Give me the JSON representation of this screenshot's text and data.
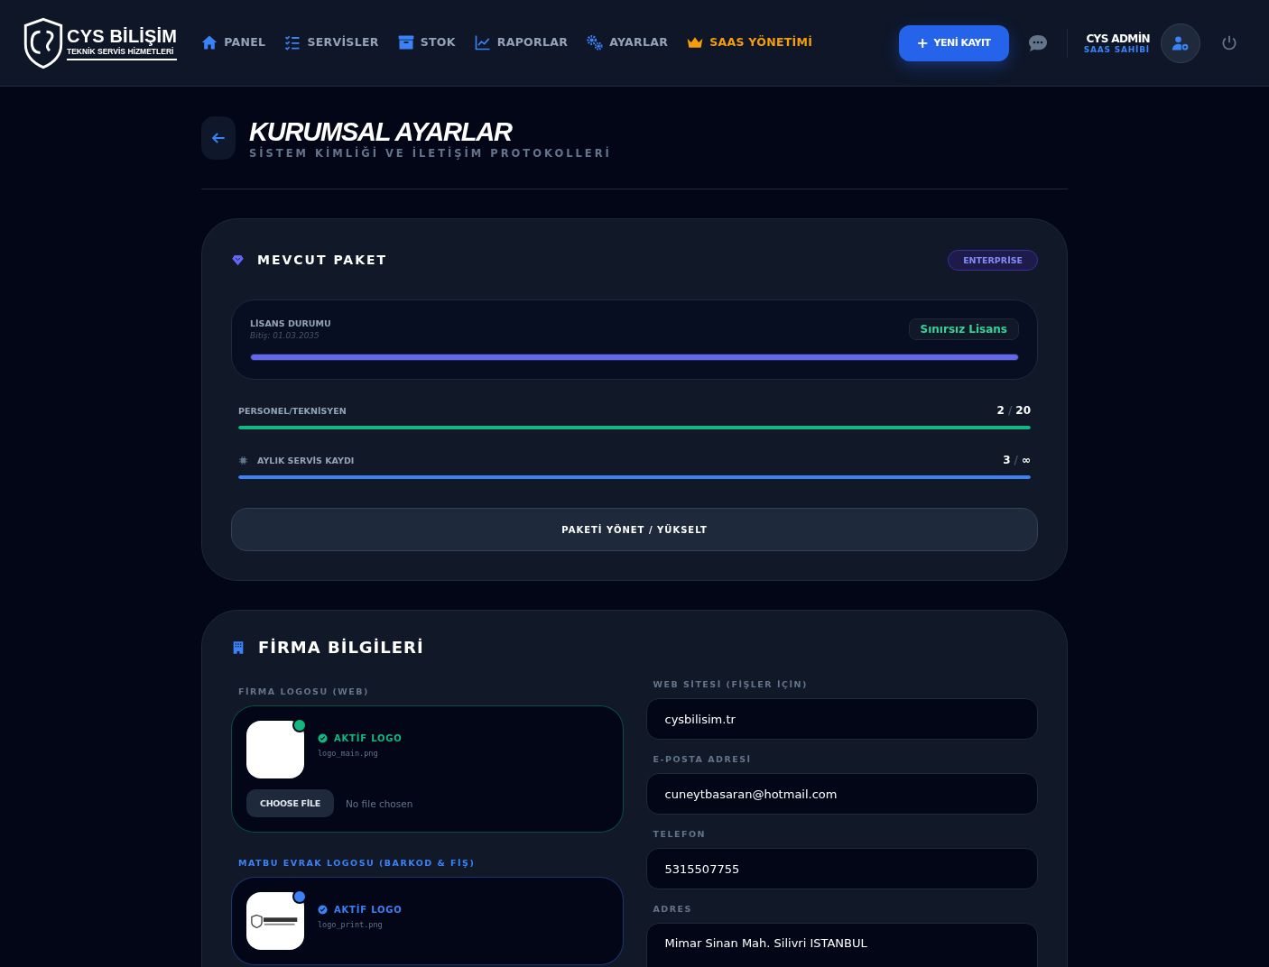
{
  "header": {
    "logo": {
      "title": "CYS BİLİŞİM",
      "subtitle": "TEKNİK SERVİS HİZMETLERİ"
    },
    "nav": [
      {
        "label": "PANEL",
        "kind": "normal"
      },
      {
        "label": "SERVİSLER",
        "kind": "normal"
      },
      {
        "label": "STOK",
        "kind": "normal"
      },
      {
        "label": "RAPORLAR",
        "kind": "normal"
      },
      {
        "label": "AYARLAR",
        "kind": "normal"
      },
      {
        "label": "SAAS YÖNETİMİ",
        "kind": "highlight"
      }
    ],
    "new_button": {
      "icon": "+",
      "label": "YENİ KAYIT"
    },
    "user": {
      "name": "CYS ADMİN",
      "role": "SAAS SAHİBİ"
    }
  },
  "page": {
    "title": "KURUMSAL AYARLAR",
    "subtitle": "SİSTEM KİMLİĞİ VE İLETİŞİM PROTOKOLLERİ"
  },
  "package": {
    "title": "MEVCUT PAKET",
    "badge": "ENTERPRİSE",
    "license": {
      "label": "LİSANS DURUMU",
      "expiry": "Bitiş: 01.03.2035",
      "status": "Sınırsız Lisans",
      "level": 1
    },
    "limits": [
      {
        "label": "PERSONEL/TEKNİSYEN",
        "used": "2",
        "separator": "/",
        "limit": "20",
        "level": 1,
        "color": "#10b981",
        "icon": false
      },
      {
        "label": "AYLIK SERVİS KAYDI",
        "used": "3",
        "separator": "/",
        "limit": "∞",
        "level": 1,
        "color": "#3b82f6",
        "icon": true
      }
    ],
    "button": "PAKETİ YÖNET / YÜKSELT"
  },
  "company": {
    "title": "FİRMA BİLGİLERİ",
    "logos": [
      {
        "label": "FİRMA LOGOSU (WEB)",
        "status": "AKTİF LOGO",
        "filename": "logo_main.png",
        "color": "#10b981",
        "button": "CHOOSE FİLE",
        "file_text": "No file chosen"
      },
      {
        "label": "MATBU EVRAK LOGOSU (BARKOD & FİŞ)",
        "status": "AKTİF LOGO",
        "filename": "logo_print.png",
        "color": "#3b82f6"
      }
    ],
    "fields": [
      {
        "label": "WEB SİTESİ (FİŞLER İÇİN)",
        "value": "cysbilisim.tr"
      },
      {
        "label": "E-POSTA ADRESİ",
        "value": "cuneytbasaran@hotmail.com"
      },
      {
        "label": "TELEFON",
        "value": "5315507755"
      },
      {
        "label": "ADRES",
        "value": "Mimar Sinan Mah. Silivri ISTANBUL",
        "kind": "textarea"
      }
    ]
  }
}
